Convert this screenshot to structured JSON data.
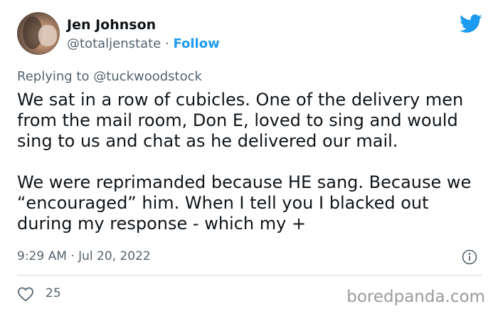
{
  "author": {
    "name": "Jen Johnson",
    "handle": "@totaljenstate",
    "separator": "·",
    "follow_label": "Follow"
  },
  "reply_context": {
    "prefix": "Replying to",
    "handle": "@tuckwoodstock"
  },
  "tweet": {
    "paragraphs": [
      "We sat in a row of cubicles. One of the delivery men from the mail room, Don E, loved to sing and would sing to us and chat as he delivered our mail.",
      "We were reprimanded because HE sang. Because we “encouraged” him. When I tell you I blacked out during my response - which my +"
    ]
  },
  "meta": {
    "timestamp": "9:29 AM · Jul 20, 2022"
  },
  "actions": {
    "like_count": "25"
  },
  "watermark": "boredpanda.com",
  "icons": {
    "brand": "twitter-bird-icon",
    "info": "info-icon",
    "like": "heart-icon"
  },
  "colors": {
    "accent": "#1d9bf0",
    "text_primary": "#0f1419",
    "text_secondary": "#536471",
    "divider": "#cfd9de"
  }
}
